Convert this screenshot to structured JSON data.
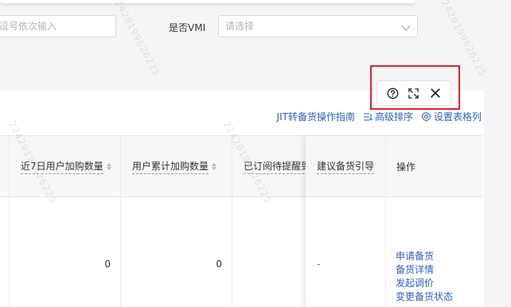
{
  "filters": {
    "left_input_placeholder": "逗号依次输入",
    "vmi_label": "是否VMI",
    "vmi_placeholder": "请选择"
  },
  "float_tools": {
    "icons": [
      "help-circle-icon",
      "expand-icon",
      "close-icon"
    ]
  },
  "toolbar_links": {
    "guide": "JIT转备货操作指南",
    "advanced_sort": "高级排序",
    "table_settings": "设置表格列"
  },
  "table": {
    "columns": [
      {
        "label": "近7日用户加购数量",
        "sortable": true
      },
      {
        "label": "用户累计加购数量",
        "sortable": true
      },
      {
        "label": "已订阅待提醒到货",
        "sortable": false
      },
      {
        "label": "建议备货引导",
        "sortable": false
      },
      {
        "label": "操作",
        "sortable": false
      }
    ],
    "row": {
      "recent7_add": "0",
      "total_add": "0",
      "suggest": "-",
      "actions": [
        "申请备货",
        "备货详情",
        "发起调价",
        "变更备货状态"
      ]
    }
  },
  "watermark": "22420199626225"
}
